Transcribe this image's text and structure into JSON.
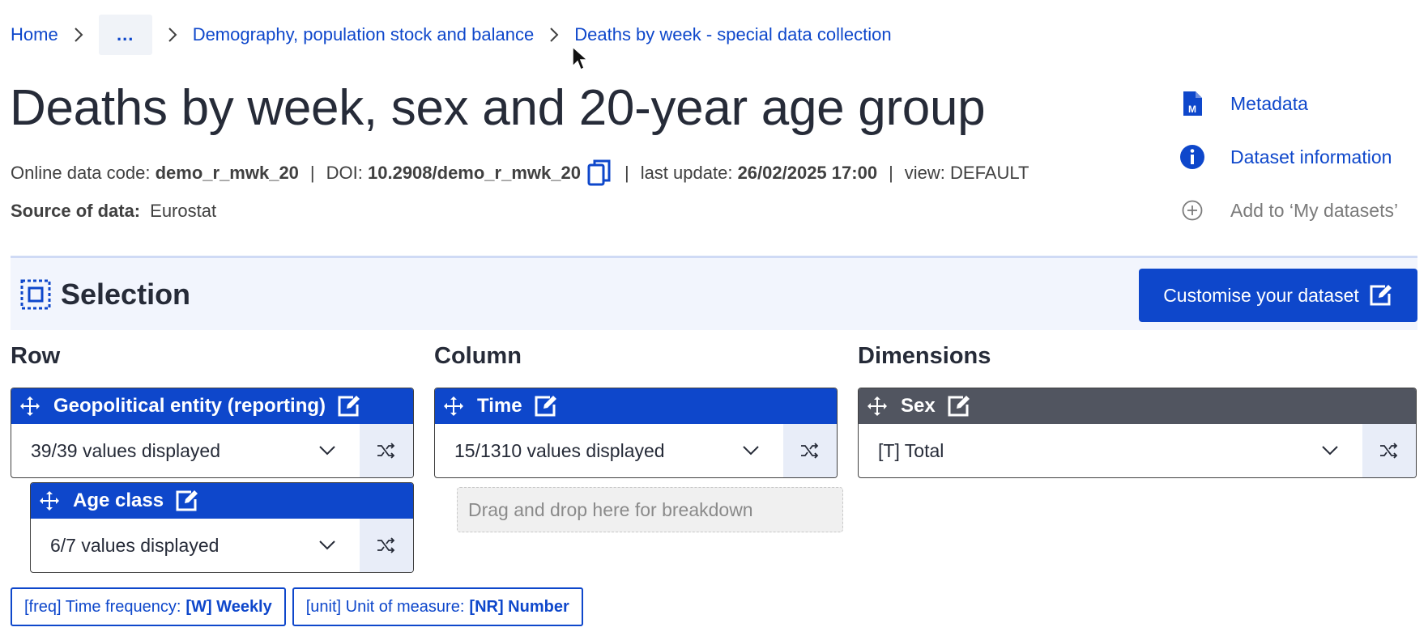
{
  "breadcrumb": {
    "home": "Home",
    "ellipsis": "...",
    "level1": "Demography, population stock and balance",
    "level2": "Deaths by week - special data collection"
  },
  "title": "Deaths by week, sex and 20-year age group",
  "meta": {
    "code_label": "Online data code:",
    "code_value": "demo_r_mwk_20",
    "sep": "|",
    "doi_label": "DOI:",
    "doi_value": "10.2908/demo_r_mwk_20",
    "update_label": "last update:",
    "update_value": "26/02/2025 17:00",
    "view_text": "view: DEFAULT"
  },
  "source": {
    "label": "Source of data:",
    "value": "Eurostat"
  },
  "side_actions": {
    "metadata": "Metadata",
    "dataset_info": "Dataset information",
    "add_my": "Add to ‘My datasets’"
  },
  "selection": {
    "title": "Selection",
    "customise": "Customise your dataset"
  },
  "sections": {
    "row": "Row",
    "column": "Column",
    "dimensions": "Dimensions"
  },
  "row_dims": [
    {
      "name": "Geopolitical entity (reporting)",
      "value": "39/39 values displayed"
    },
    {
      "name": "Age class",
      "value": "6/7 values displayed"
    }
  ],
  "column_dims": [
    {
      "name": "Time",
      "value": "15/1310 values displayed"
    }
  ],
  "other_dims": [
    {
      "name": "Sex",
      "value": "[T] Total"
    }
  ],
  "dropzone": "Drag and drop here for breakdown",
  "chips": [
    {
      "label": "[freq] Time frequency:",
      "value": "[W] Weekly"
    },
    {
      "label": "[unit] Unit of measure:",
      "value": "[NR] Number"
    }
  ],
  "colors": {
    "primary": "#0e47cb",
    "dark_header": "#515560",
    "selection_bg": "#f2f5fd"
  }
}
